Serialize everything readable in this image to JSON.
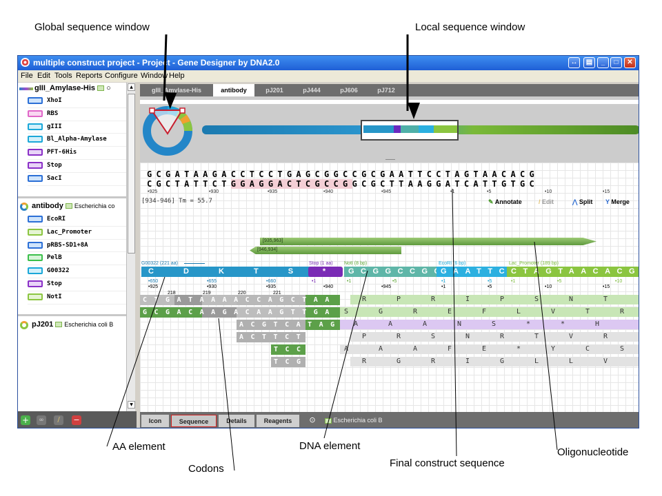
{
  "callouts": {
    "global": "Global sequence window",
    "local": "Local sequence window",
    "aa": "AA element",
    "codons": "Codons",
    "dna": "DNA element",
    "final": "Final construct sequence",
    "oligo": "Oligonucleotide"
  },
  "window": {
    "title": "multiple construct project - Project - Gene Designer by DNA2.0",
    "menu": [
      "File",
      "Edit",
      "Tools",
      "Reports",
      "Configure",
      "Window",
      "Help"
    ]
  },
  "left": {
    "groups": [
      {
        "name": "gIII_Amylase-His",
        "organism": "",
        "items": [
          "XhoI",
          "RBS",
          "gIII",
          "Bl_Alpha-Amylase",
          "PFT-6His",
          "Stop",
          "SacI"
        ]
      },
      {
        "name": "antibody",
        "organism": "Escherichia co",
        "items": [
          "EcoRI",
          "Lac_Promoter",
          "pRBS-SD1+8A",
          "PelB",
          "G00322",
          "Stop",
          "NotI"
        ]
      },
      {
        "name": "pJ201",
        "organism": "Escherichia coli B",
        "items": []
      }
    ]
  },
  "tabs": [
    "gIII_Amylase-His",
    "antibody",
    "pJ201",
    "pJ444",
    "pJ606",
    "pJ712"
  ],
  "sequence": {
    "top": "GCGATAAGACCTCCTGAGCGGCCGCGAATTCCTAGTAACACG",
    "bottom_a": "CGCTATTCT",
    "bottom_b": "GGAGGACTCGCCG",
    "bottom_c": "GCGCTTAAGGATCATTGTGC",
    "pos_labels": [
      "•925",
      "•930",
      "•935",
      "•940",
      "•945",
      "•1",
      "•5",
      "•10",
      "•15"
    ],
    "tm": "[934-946] Tm = 55.7",
    "tools": [
      "Annotate",
      "Edit",
      "Split",
      "Merge"
    ]
  },
  "oligos": [
    "[935,963]",
    "[946,934]"
  ],
  "features": {
    "g00322": "G00322 (221 aa)",
    "stop": "Stop (1 aa)",
    "noti": "NotI (8 bp)",
    "ecori": "EcoRI (6 bp)",
    "lac": "Lac_Promoter (189 bp)",
    "aa_letters": "C   D   K   T   S",
    "stop_char": "*",
    "noti_seq": "GCGGCCGC",
    "ecori_seq": "GAATTC",
    "lac_seq": "CTAGTAACACG"
  },
  "marks": {
    "row1": [
      "•650",
      "•655",
      "•660",
      "•1",
      "•1",
      "•5",
      "•1",
      "•5",
      "•1",
      "•5",
      "•10"
    ],
    "row2": [
      "•925",
      "•930",
      "•935",
      "•940",
      "•945",
      "•1",
      "•5",
      "•10",
      "•15"
    ],
    "nums": [
      "218",
      "219",
      "220",
      "221"
    ]
  },
  "codons": {
    "r1a": "CTGATAAAACCAGCTAA",
    "r2": "GCGACAAGACAAGTTGA",
    "r3": "ACGTCATAG",
    "r4": "ACTTCT",
    "r5": "TCC",
    "r6": "TCG"
  },
  "frames": {
    "f1": [
      "R",
      "P",
      "R",
      "I",
      "P",
      "S",
      "N",
      "T"
    ],
    "f2": [
      "S",
      "G",
      "R",
      "E",
      "F",
      "L",
      "V",
      "T",
      "R"
    ],
    "f3": [
      "A",
      "A",
      "A",
      "N",
      "S",
      "*",
      "*",
      "H"
    ],
    "f4": [
      "P",
      "R",
      "S",
      "N",
      "R",
      "T",
      "V",
      "R"
    ],
    "f5": [
      "A",
      "A",
      "A",
      "F",
      "E",
      "*",
      "Y",
      "C",
      "S"
    ],
    "f6": [
      "R",
      "G",
      "R",
      "I",
      "G",
      "L",
      "L",
      "V"
    ]
  },
  "bottom_tabs": [
    "Icon",
    "Sequence",
    "Details",
    "Reagents"
  ],
  "organism": "Escherichia coli B"
}
